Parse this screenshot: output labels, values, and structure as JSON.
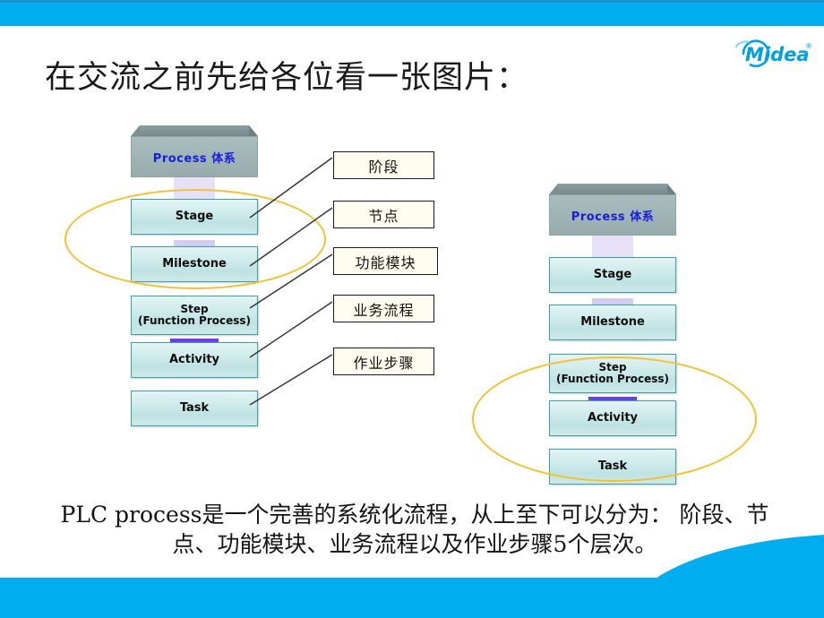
{
  "slide": {
    "title": "在交流之前先给各位看一张图片：",
    "summary_line1": "PLC process是一个完善的系统化流程，从上至下可以分为：",
    "summary_line2": "阶段、节点、功能模块、业务流程以及作业步骤5个层次。"
  },
  "brand": {
    "name": "Midea",
    "trademark": "®",
    "logo_color": "#00A0E0"
  },
  "theme": {
    "bar_blue": "#00AEEF",
    "bar_blue_dark": "#1893CE",
    "node_border_teal": "#3FA0A4",
    "node_fill_light": "#E4F4F4",
    "header_gray": "#9FB4B4",
    "arrow_purple": "#6B3FEF",
    "arrow_lavender": "#D9D2F5",
    "highlight_yellow": "#F0C231",
    "callout_fill": "#FFFDF0",
    "process_label_blue": "#1B1BE0"
  },
  "left_diagram": {
    "top_box_label": "Process 体系",
    "nodes": [
      {
        "label": "Stage",
        "label2": ""
      },
      {
        "label": "Milestone",
        "label2": ""
      },
      {
        "label": "Step",
        "label2": "(Function Process)"
      },
      {
        "label": "Activity",
        "label2": ""
      },
      {
        "label": "Task",
        "label2": ""
      }
    ],
    "highlight_targets": [
      "Stage",
      "Milestone"
    ]
  },
  "right_diagram": {
    "top_box_label": "Process 体系",
    "nodes": [
      {
        "label": "Stage",
        "label2": ""
      },
      {
        "label": "Milestone",
        "label2": ""
      },
      {
        "label": "Step",
        "label2": "(Function Process)"
      },
      {
        "label": "Activity",
        "label2": ""
      },
      {
        "label": "Task",
        "label2": ""
      }
    ],
    "highlight_targets": [
      "Step",
      "Activity",
      "Task"
    ]
  },
  "callouts": [
    {
      "label": "阶段"
    },
    {
      "label": "节点"
    },
    {
      "label": "功能模块"
    },
    {
      "label": "业务流程"
    },
    {
      "label": "作业步骤"
    }
  ]
}
